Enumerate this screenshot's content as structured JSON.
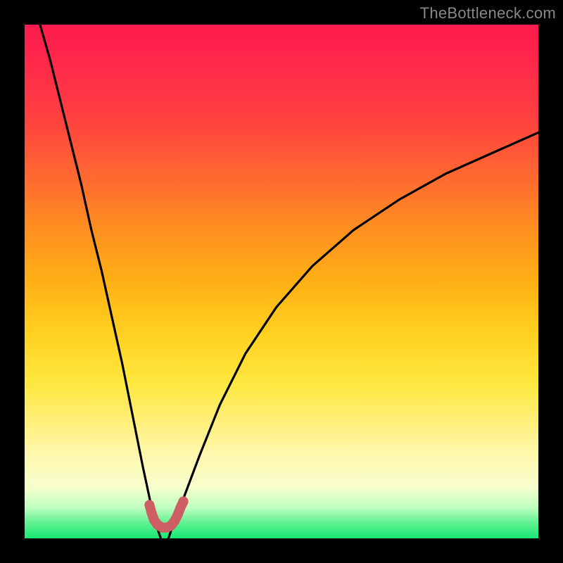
{
  "watermark": "TheBottleneck.com",
  "colors": {
    "bg_frame": "#000000",
    "curve": "#000000",
    "marker_stroke": "#cd5e63",
    "marker_fill": "#cd5e63"
  },
  "chart_data": {
    "type": "line",
    "title": "",
    "xlabel": "",
    "ylabel": "",
    "xlim": [
      0,
      100
    ],
    "ylim": [
      0,
      100
    ],
    "grid": false,
    "legend": false,
    "note": "No numeric axis ticks or labels are rendered in the image; values are relative positions read off the pixel grid (0–100).",
    "series": [
      {
        "name": "curve-left",
        "x": [
          3,
          5,
          7,
          9,
          11,
          13,
          15,
          17,
          19,
          21,
          23,
          24.5,
          25.5,
          26.5
        ],
        "y": [
          100,
          93,
          85,
          77,
          69,
          60,
          52,
          43,
          34,
          24,
          14,
          7,
          3,
          0
        ],
        "stroke": "#000000"
      },
      {
        "name": "curve-right",
        "x": [
          28,
          29,
          31,
          34,
          38,
          43,
          49,
          56,
          64,
          73,
          82,
          91,
          100
        ],
        "y": [
          0,
          3,
          8,
          16,
          26,
          36,
          45,
          53,
          60,
          66,
          71,
          75,
          79
        ],
        "stroke": "#000000"
      }
    ],
    "markers": {
      "name": "bottom-u-shape",
      "points_xy": [
        [
          24.3,
          6.5
        ],
        [
          24.7,
          5.0
        ],
        [
          25.2,
          3.6
        ],
        [
          25.9,
          2.6
        ],
        [
          26.8,
          2.1
        ],
        [
          27.7,
          2.1
        ],
        [
          28.5,
          2.5
        ],
        [
          29.2,
          3.4
        ],
        [
          29.8,
          4.6
        ],
        [
          30.3,
          5.9
        ],
        [
          30.9,
          7.2
        ]
      ],
      "color": "#cd5e63",
      "radius_px": 7
    }
  }
}
